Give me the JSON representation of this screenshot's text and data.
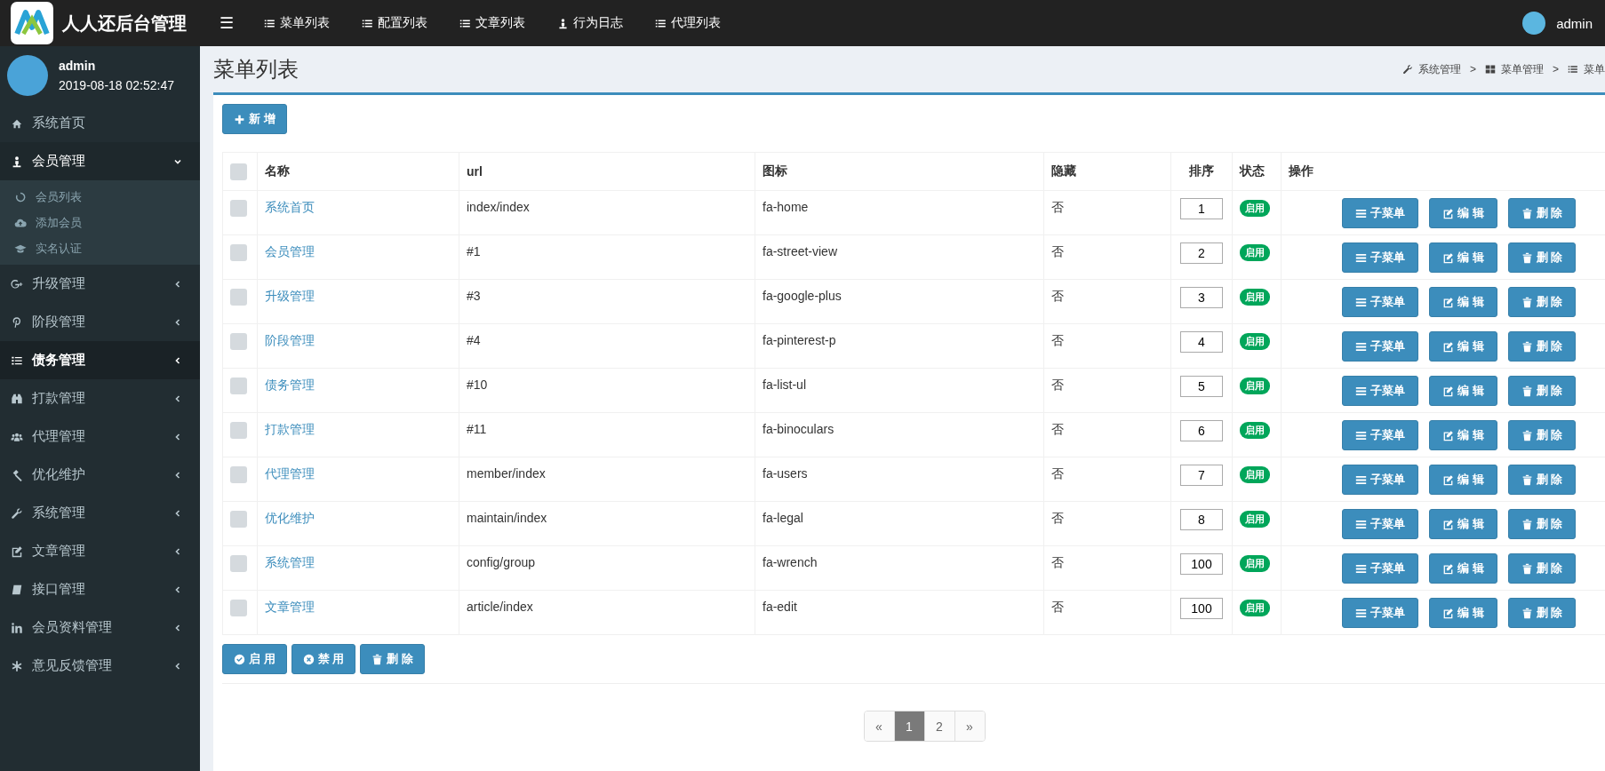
{
  "brand": {
    "title": "人人还后台管理"
  },
  "top_nav": {
    "toggle": "☰",
    "items": [
      {
        "label": "菜单列表"
      },
      {
        "label": "配置列表"
      },
      {
        "label": "文章列表"
      },
      {
        "label": "行为日志"
      },
      {
        "label": "代理列表"
      }
    ],
    "user": "admin"
  },
  "sidebar": {
    "user": {
      "name": "admin",
      "time": "2019-08-18 02:52:47"
    },
    "items": [
      {
        "label": "系统首页",
        "selected": false,
        "expanded": false,
        "has_children": false
      },
      {
        "label": "会员管理",
        "selected": false,
        "expanded": true,
        "has_children": true,
        "children": [
          {
            "label": "会员列表"
          },
          {
            "label": "添加会员"
          },
          {
            "label": "实名认证"
          }
        ]
      },
      {
        "label": "升级管理",
        "selected": false,
        "expanded": false,
        "has_children": true
      },
      {
        "label": "阶段管理",
        "selected": false,
        "expanded": false,
        "has_children": true
      },
      {
        "label": "债务管理",
        "selected": true,
        "expanded": false,
        "has_children": true
      },
      {
        "label": "打款管理",
        "selected": false,
        "expanded": false,
        "has_children": true
      },
      {
        "label": "代理管理",
        "selected": false,
        "expanded": false,
        "has_children": true
      },
      {
        "label": "优化维护",
        "selected": false,
        "expanded": false,
        "has_children": true
      },
      {
        "label": "系统管理",
        "selected": false,
        "expanded": false,
        "has_children": true
      },
      {
        "label": "文章管理",
        "selected": false,
        "expanded": false,
        "has_children": true
      },
      {
        "label": "接口管理",
        "selected": false,
        "expanded": false,
        "has_children": true
      },
      {
        "label": "会员资料管理",
        "selected": false,
        "expanded": false,
        "has_children": true
      },
      {
        "label": "意见反馈管理",
        "selected": false,
        "expanded": false,
        "has_children": true
      }
    ]
  },
  "page": {
    "title": "菜单列表",
    "breadcrumb": [
      {
        "label": "系统管理"
      },
      {
        "label": "菜单管理"
      },
      {
        "label": "菜单"
      }
    ],
    "separator": ">"
  },
  "toolbar": {
    "add_button": "新 增"
  },
  "table": {
    "header_checked": false,
    "columns": [
      "名称",
      "url",
      "图标",
      "隐藏",
      "排序",
      "状态",
      "操作"
    ],
    "rows": [
      {
        "checked": false,
        "name": "系统首页",
        "url": "index/index",
        "icon": "fa-home",
        "hidden": "否",
        "sort": "1",
        "status": "启用",
        "actions": [
          "子菜单",
          "编 辑",
          "删 除"
        ]
      },
      {
        "checked": false,
        "name": "会员管理",
        "url": "#1",
        "icon": "fa-street-view",
        "hidden": "否",
        "sort": "2",
        "status": "启用",
        "actions": [
          "子菜单",
          "编 辑",
          "删 除"
        ]
      },
      {
        "checked": false,
        "name": "升级管理",
        "url": "#3",
        "icon": "fa-google-plus",
        "hidden": "否",
        "sort": "3",
        "status": "启用",
        "actions": [
          "子菜单",
          "编 辑",
          "删 除"
        ]
      },
      {
        "checked": false,
        "name": "阶段管理",
        "url": "#4",
        "icon": "fa-pinterest-p",
        "hidden": "否",
        "sort": "4",
        "status": "启用",
        "actions": [
          "子菜单",
          "编 辑",
          "删 除"
        ]
      },
      {
        "checked": false,
        "name": "债务管理",
        "url": "#10",
        "icon": "fa-list-ul",
        "hidden": "否",
        "sort": "5",
        "status": "启用",
        "actions": [
          "子菜单",
          "编 辑",
          "删 除"
        ]
      },
      {
        "checked": false,
        "name": "打款管理",
        "url": "#11",
        "icon": "fa-binoculars",
        "hidden": "否",
        "sort": "6",
        "status": "启用",
        "actions": [
          "子菜单",
          "编 辑",
          "删 除"
        ]
      },
      {
        "checked": false,
        "name": "代理管理",
        "url": "member/index",
        "icon": "fa-users",
        "hidden": "否",
        "sort": "7",
        "status": "启用",
        "actions": [
          "子菜单",
          "编 辑",
          "删 除"
        ]
      },
      {
        "checked": false,
        "name": "优化维护",
        "url": "maintain/index",
        "icon": "fa-legal",
        "hidden": "否",
        "sort": "8",
        "status": "启用",
        "actions": [
          "子菜单",
          "编 辑",
          "删 除"
        ]
      },
      {
        "checked": false,
        "name": "系统管理",
        "url": "config/group",
        "icon": "fa-wrench",
        "hidden": "否",
        "sort": "100",
        "status": "启用",
        "actions": [
          "子菜单",
          "编 辑",
          "删 除"
        ]
      },
      {
        "checked": false,
        "name": "文章管理",
        "url": "article/index",
        "icon": "fa-edit",
        "hidden": "否",
        "sort": "100",
        "status": "启用",
        "actions": [
          "子菜单",
          "编 辑",
          "删 除"
        ]
      }
    ]
  },
  "bulk_actions": [
    "启 用",
    "禁 用",
    "删 除"
  ],
  "pagination": {
    "prev": "«",
    "next": "»",
    "pages": [
      {
        "label": "1",
        "selected": true
      },
      {
        "label": "2",
        "selected": false
      }
    ]
  }
}
